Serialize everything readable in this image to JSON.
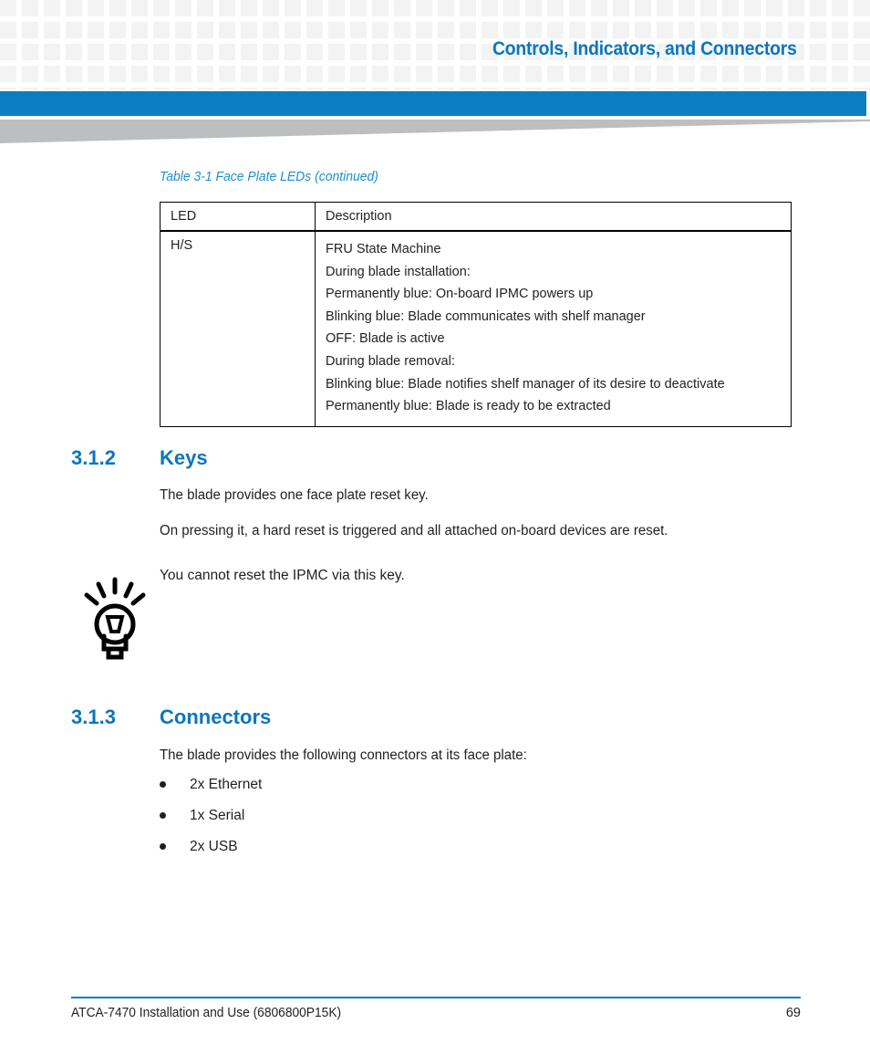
{
  "header": {
    "title": "Controls, Indicators, and Connectors",
    "accent_blue": "#0b76bc",
    "bar_blue": "#0b7ec1",
    "grid_square_color": "#f3f3f3",
    "wedge_gray": "#bcbec0"
  },
  "table": {
    "caption": "Table 3-1 Face Plate LEDs (continued)",
    "columns": [
      "LED",
      "Description"
    ],
    "rows": [
      {
        "led": "H/S",
        "description_lines": [
          "FRU State Machine",
          "During blade installation:",
          "Permanently blue: On-board IPMC powers up",
          "Blinking blue: Blade communicates with shelf manager",
          "OFF: Blade is active",
          "During blade removal:",
          "Blinking blue: Blade notifies shelf manager of its desire to deactivate",
          "Permanently blue: Blade is ready to be extracted"
        ]
      }
    ]
  },
  "sections": [
    {
      "number": "3.1.2",
      "title": "Keys",
      "paragraphs": [
        "The blade provides one face plate reset key.",
        "On pressing it, a hard reset is triggered and all attached on-board devices are reset."
      ]
    },
    {
      "number": "3.1.3",
      "title": "Connectors",
      "paragraphs": [
        "The blade provides the following connectors at its face plate:"
      ]
    }
  ],
  "tip": {
    "icon": "lightbulb-icon",
    "text": "You cannot reset the IPMC via this key."
  },
  "connectors": [
    "2x Ethernet",
    "1x Serial",
    "2x USB"
  ],
  "footer": {
    "document": "ATCA-7470 Installation and Use (6806800P15K)",
    "page_number": "69",
    "rule_color": "#0b7ec1"
  }
}
